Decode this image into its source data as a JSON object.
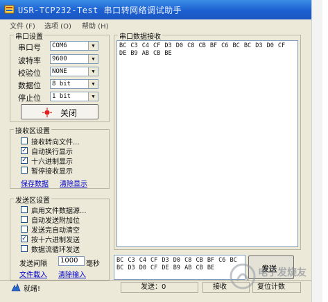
{
  "window": {
    "title": "USR-TCP232-Test  串口转网络调试助手"
  },
  "menu": {
    "items": [
      "文件 (F)",
      "选项 (O)",
      "帮助 (H)"
    ]
  },
  "serial_settings": {
    "title": "串口设置",
    "fields": [
      {
        "label": "串口号",
        "value": "COM6"
      },
      {
        "label": "波特率",
        "value": "9600"
      },
      {
        "label": "校验位",
        "value": "NONE"
      },
      {
        "label": "数据位",
        "value": "8 bit"
      },
      {
        "label": "停止位",
        "value": "1 bit"
      }
    ],
    "toggle_button": "关闭",
    "status_color": "#e02020"
  },
  "receive_settings": {
    "title": "接收区设置",
    "options": [
      {
        "label": "接收转向文件...",
        "checked": false
      },
      {
        "label": "自动换行显示",
        "checked": true
      },
      {
        "label": "十六进制显示",
        "checked": true
      },
      {
        "label": "暂停接收显示",
        "checked": false
      }
    ],
    "save_link": "保存数据",
    "clear_link": "清除显示"
  },
  "send_settings": {
    "title": "发送区设置",
    "options": [
      {
        "label": "启用文件数据源...",
        "checked": false
      },
      {
        "label": "自动发送附加位",
        "checked": false
      },
      {
        "label": "发送完自动清空",
        "checked": false
      },
      {
        "label": "按十六进制发送",
        "checked": true
      },
      {
        "label": "数据流循环发送",
        "checked": false
      }
    ],
    "interval_label": "发送间隔",
    "interval_value": "1000",
    "interval_unit": "毫秒",
    "load_link": "文件载入",
    "clear_link": "清除输入"
  },
  "receive_area": {
    "title": "串口数据接收",
    "content": "BC C3 C4 CF D3 D0 C8 CB BF C6 BC BC D3 D0 CF DE B9 AB CB BE"
  },
  "send_area": {
    "content": "BC C3 C4 CF D3 D0 C8 CB BF C6 BC BC D3 D0 CF DE B9 AB CB BE",
    "send_button": "发送"
  },
  "status_bar": {
    "state": "就绪!",
    "sent": "发送：0",
    "received": "接收",
    "reset": "复位计数"
  },
  "watermark": "电子发烧友 www.elecfans.com"
}
